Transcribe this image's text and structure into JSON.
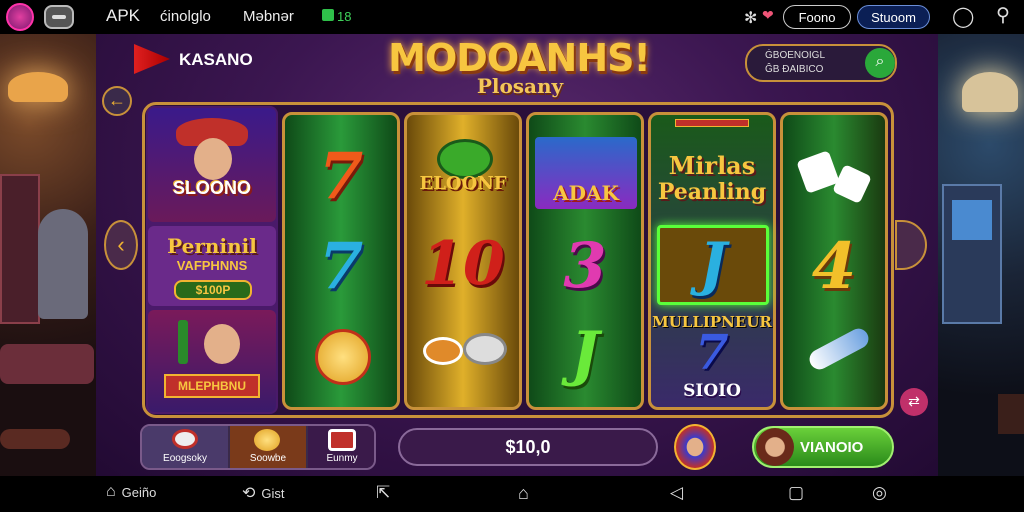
{
  "status_bar": {
    "apk": "APK",
    "app1": "ćinolglo",
    "app2": "Məbnər",
    "badge": "18",
    "btn_left": "Foono",
    "btn_right": "Stuoom"
  },
  "header": {
    "brand": "KASANO",
    "title": "MODOANHS!",
    "subtitle": "Plosany",
    "info_line1": "ĠBOENOIGL",
    "info_line2": "ĜB ĐAIBICO"
  },
  "left_panel": {
    "card1": "SLOONO",
    "card2_line1": "Perninil",
    "card2_line2": "VAFPHNNS",
    "badge": "$100P",
    "card3": "MLEPHBNU"
  },
  "reels": {
    "r1": [
      "7",
      "7",
      ""
    ],
    "r2": [
      "ELOONF",
      "10",
      ""
    ],
    "r3": [
      "ADAK",
      "3",
      "J"
    ],
    "r4_line1": "Mirlas",
    "r4_line2": "Peanling",
    "r4_mid": "J",
    "r4_banner": "MULLIPNEUR",
    "r4_bottom": "7",
    "r4_label": "SIOIO",
    "r5": [
      "",
      "4",
      ""
    ]
  },
  "bottom": {
    "tab1": "Eoogsoky",
    "tab2": "Soowbe",
    "tab3": "Eunmy",
    "bet": "$10,0",
    "action": "VIANOIO"
  },
  "nav": {
    "n1": "Geiño",
    "n2": "Gist"
  },
  "colors": {
    "gold": "#f2b431",
    "reel_green": "#1f7a2a",
    "reel_gold": "#b98a1a",
    "purple": "#3b1650",
    "action_green": "#4cae1f"
  }
}
